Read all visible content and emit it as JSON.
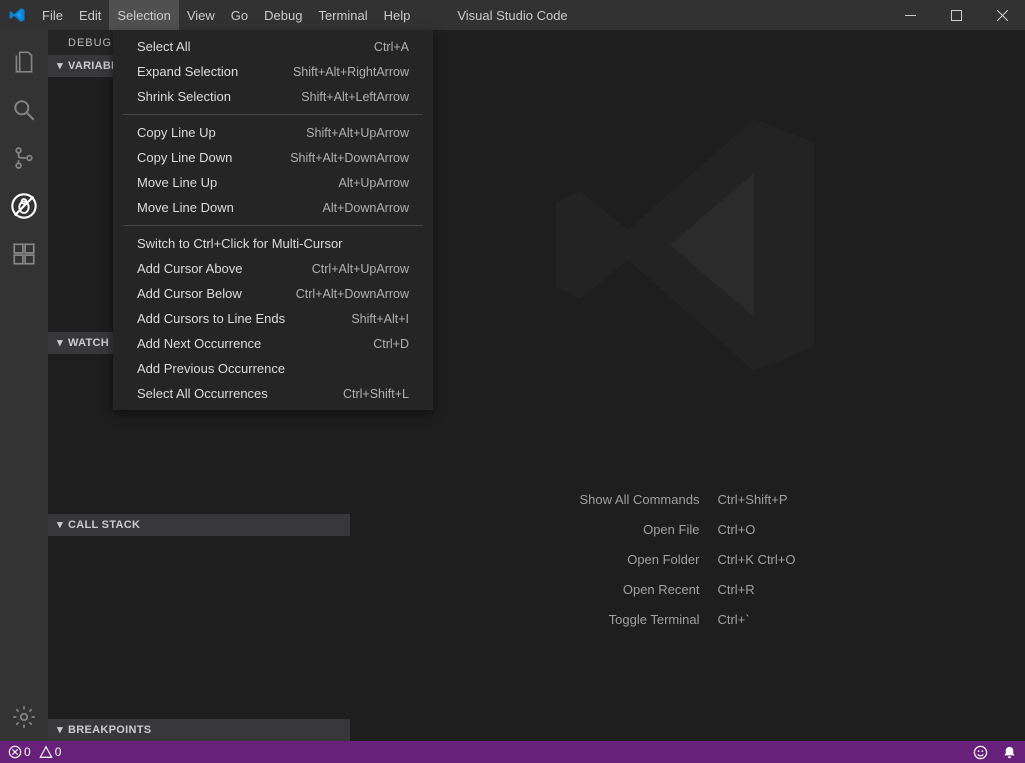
{
  "title": "Visual Studio Code",
  "menubar": [
    "File",
    "Edit",
    "Selection",
    "View",
    "Go",
    "Debug",
    "Terminal",
    "Help"
  ],
  "activeMenu": "Selection",
  "dropdown": {
    "groups": [
      [
        {
          "label": "Select All",
          "accel": "Ctrl+A"
        },
        {
          "label": "Expand Selection",
          "accel": "Shift+Alt+RightArrow"
        },
        {
          "label": "Shrink Selection",
          "accel": "Shift+Alt+LeftArrow"
        }
      ],
      [
        {
          "label": "Copy Line Up",
          "accel": "Shift+Alt+UpArrow"
        },
        {
          "label": "Copy Line Down",
          "accel": "Shift+Alt+DownArrow"
        },
        {
          "label": "Move Line Up",
          "accel": "Alt+UpArrow"
        },
        {
          "label": "Move Line Down",
          "accel": "Alt+DownArrow"
        }
      ],
      [
        {
          "label": "Switch to Ctrl+Click for Multi-Cursor",
          "accel": ""
        },
        {
          "label": "Add Cursor Above",
          "accel": "Ctrl+Alt+UpArrow"
        },
        {
          "label": "Add Cursor Below",
          "accel": "Ctrl+Alt+DownArrow"
        },
        {
          "label": "Add Cursors to Line Ends",
          "accel": "Shift+Alt+I"
        },
        {
          "label": "Add Next Occurrence",
          "accel": "Ctrl+D"
        },
        {
          "label": "Add Previous Occurrence",
          "accel": ""
        },
        {
          "label": "Select All Occurrences",
          "accel": "Ctrl+Shift+L"
        }
      ]
    ]
  },
  "sidebar": {
    "title": "DEBUG",
    "panels": [
      "VARIABLES",
      "WATCH",
      "CALL STACK",
      "BREAKPOINTS"
    ]
  },
  "welcome": {
    "shortcuts": [
      {
        "label": "Show All Commands",
        "key": "Ctrl+Shift+P"
      },
      {
        "label": "Open File",
        "key": "Ctrl+O"
      },
      {
        "label": "Open Folder",
        "key": "Ctrl+K Ctrl+O"
      },
      {
        "label": "Open Recent",
        "key": "Ctrl+R"
      },
      {
        "label": "Toggle Terminal",
        "key": "Ctrl+`"
      }
    ]
  },
  "statusbar": {
    "errors": "0",
    "warnings": "0"
  },
  "colors": {
    "statusbar": "#68217a",
    "bg": "#1e1e1e",
    "sidebar": "#252526",
    "activitybar": "#333333",
    "titlebar": "#323233"
  }
}
